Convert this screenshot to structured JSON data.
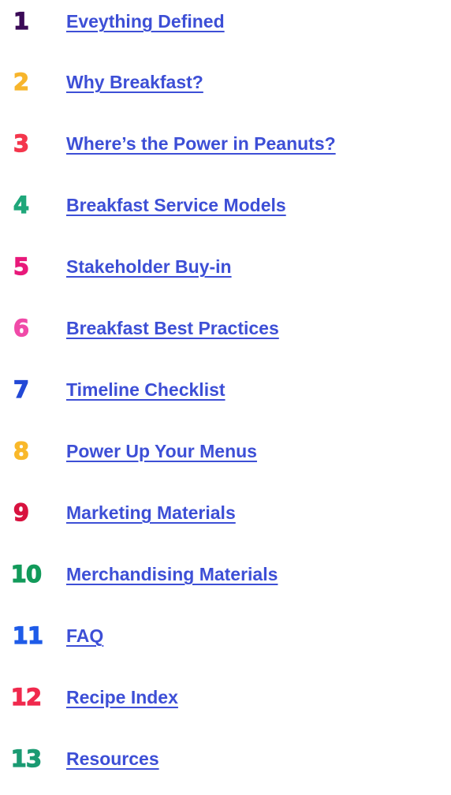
{
  "link_color": "#3d4fd6",
  "toc": {
    "items": [
      {
        "number": "1",
        "label": "Eveything Defined",
        "color": "#3b0a57"
      },
      {
        "number": "2",
        "label": "Why Breakfast?",
        "color": "#f7b52c"
      },
      {
        "number": "3",
        "label": "Where’s the Power in Peanuts?",
        "color": "#f4364c"
      },
      {
        "number": "4",
        "label": "Breakfast Service Models",
        "color": "#1fa77a"
      },
      {
        "number": "5",
        "label": "Stakeholder Buy-in",
        "color": "#e8197a"
      },
      {
        "number": "6",
        "label": "Breakfast Best Practices",
        "color": "#f04aa8"
      },
      {
        "number": "7",
        "label": "Timeline Checklist",
        "color": "#2349d6"
      },
      {
        "number": "8",
        "label": "Power Up Your Menus",
        "color": "#f9b82a"
      },
      {
        "number": "9",
        "label": "Marketing Materials",
        "color": "#d8123f"
      },
      {
        "number": "10",
        "label": "Merchandising Materials",
        "color": "#129a5a"
      },
      {
        "number": "11",
        "label": "FAQ",
        "color": "#1e5be8"
      },
      {
        "number": "12",
        "label": "Recipe Index",
        "color": "#f0294d"
      },
      {
        "number": "13",
        "label": "Resources",
        "color": "#1a9a72"
      }
    ]
  }
}
